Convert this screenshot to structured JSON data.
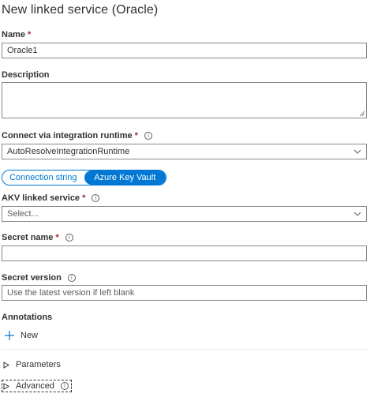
{
  "panel": {
    "title": "New linked service (Oracle)"
  },
  "name_field": {
    "label": "Name",
    "required_mark": "*",
    "value": "Oracle1"
  },
  "description_field": {
    "label": "Description",
    "value": ""
  },
  "runtime_field": {
    "label": "Connect via integration runtime",
    "required_mark": "*",
    "info_icon": "info-icon",
    "selected": "AutoResolveIntegrationRuntime"
  },
  "auth_toggle": {
    "options": [
      "Connection string",
      "Azure Key Vault"
    ],
    "selected": "Azure Key Vault",
    "accent_color": "#0078d4"
  },
  "akv_field": {
    "label": "AKV linked service",
    "required_mark": "*",
    "info_icon": "info-icon",
    "placeholder": "Select..."
  },
  "secret_name_field": {
    "label": "Secret name",
    "required_mark": "*",
    "info_icon": "info-icon",
    "value": ""
  },
  "secret_version_field": {
    "label": "Secret version",
    "info_icon": "info-icon",
    "placeholder": "Use the latest version if left blank"
  },
  "annotations": {
    "label": "Annotations",
    "new_button_label": "New",
    "new_icon": "plus-icon"
  },
  "sections": {
    "parameters_label": "Parameters",
    "advanced_label": "Advanced"
  },
  "colors": {
    "required": "#a4262c",
    "border": "#8a8886",
    "text": "#323130"
  }
}
